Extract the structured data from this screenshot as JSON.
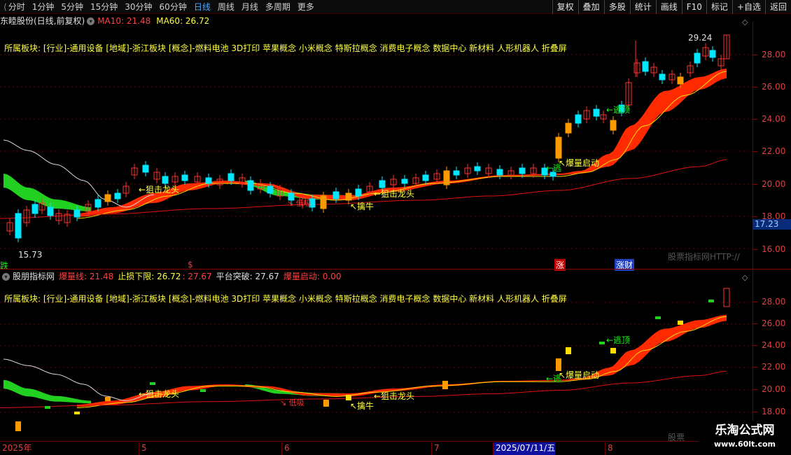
{
  "periods": [
    "分时",
    "1分钟",
    "5分钟",
    "15分钟",
    "30分钟",
    "60分钟",
    "日线",
    "周线",
    "月线",
    "多周期",
    "更多"
  ],
  "active_period": "日线",
  "toolbar_right": [
    "复权",
    "叠加",
    "多股",
    "统计",
    "画线",
    "F10",
    "标记",
    "+自选",
    "返回"
  ],
  "main_legend": {
    "stock": "东睦股份(日线,前复权)",
    "ma10_label": "MA10: 21.48",
    "ma60_label": "MA60: 26.72"
  },
  "board_text": "所属板块: [行业]-通用设备 [地域]-浙江板块 [概念]-燃料电池 3D打印 苹果概念 小米概念 特斯拉概念 消费电子概念 数据中心 新材料 人形机器人 折叠屏",
  "sub_legend": {
    "name": "股朋指标网",
    "l1": "爆量线: 21.48",
    "l2": "止损下限: 26.72",
    "l3": ": 27.67",
    "l4": "平台突破: 27.67",
    "l5": "爆量启动: 0.00"
  },
  "main_axis_ticks": [
    "28.00",
    "26.00",
    "24.00",
    "22.00",
    "20.00",
    "18.00",
    "16.00"
  ],
  "sub_axis_ticks": [
    "28.00",
    "26.00",
    "24.00",
    "22.00",
    "20.00",
    "18.00"
  ],
  "current_price_tag": "17.23",
  "high_label": "29.24",
  "low_label": "15.73",
  "annotations": {
    "snipe": "←狙击龙头",
    "snipe2": "←狙击龙头",
    "catch_bull": "↖擒牛",
    "escape_top": "←逃顶",
    "escape_top_short": "←逃",
    "surge_start": "↖爆量启动",
    "slope": "↘ 低吸"
  },
  "markers": {
    "fall": "跌",
    "dollar": "$",
    "rise": "涨",
    "bull": "涨财"
  },
  "site_text_1": "股票指标网HTTP://",
  "site_text_2": "股票",
  "date_axis": [
    "2025年",
    "5",
    "6",
    "7",
    "2025/07/11/五",
    "8"
  ],
  "watermark": {
    "title": "乐淘公式网",
    "url": "www.60lt.com"
  },
  "colors": {
    "up": "#ff3030",
    "down": "#00e8ff",
    "ma_green": "#22d022",
    "band_red": "#ff2a00",
    "yellow": "#ffdd00",
    "orange": "#ff9900"
  }
}
